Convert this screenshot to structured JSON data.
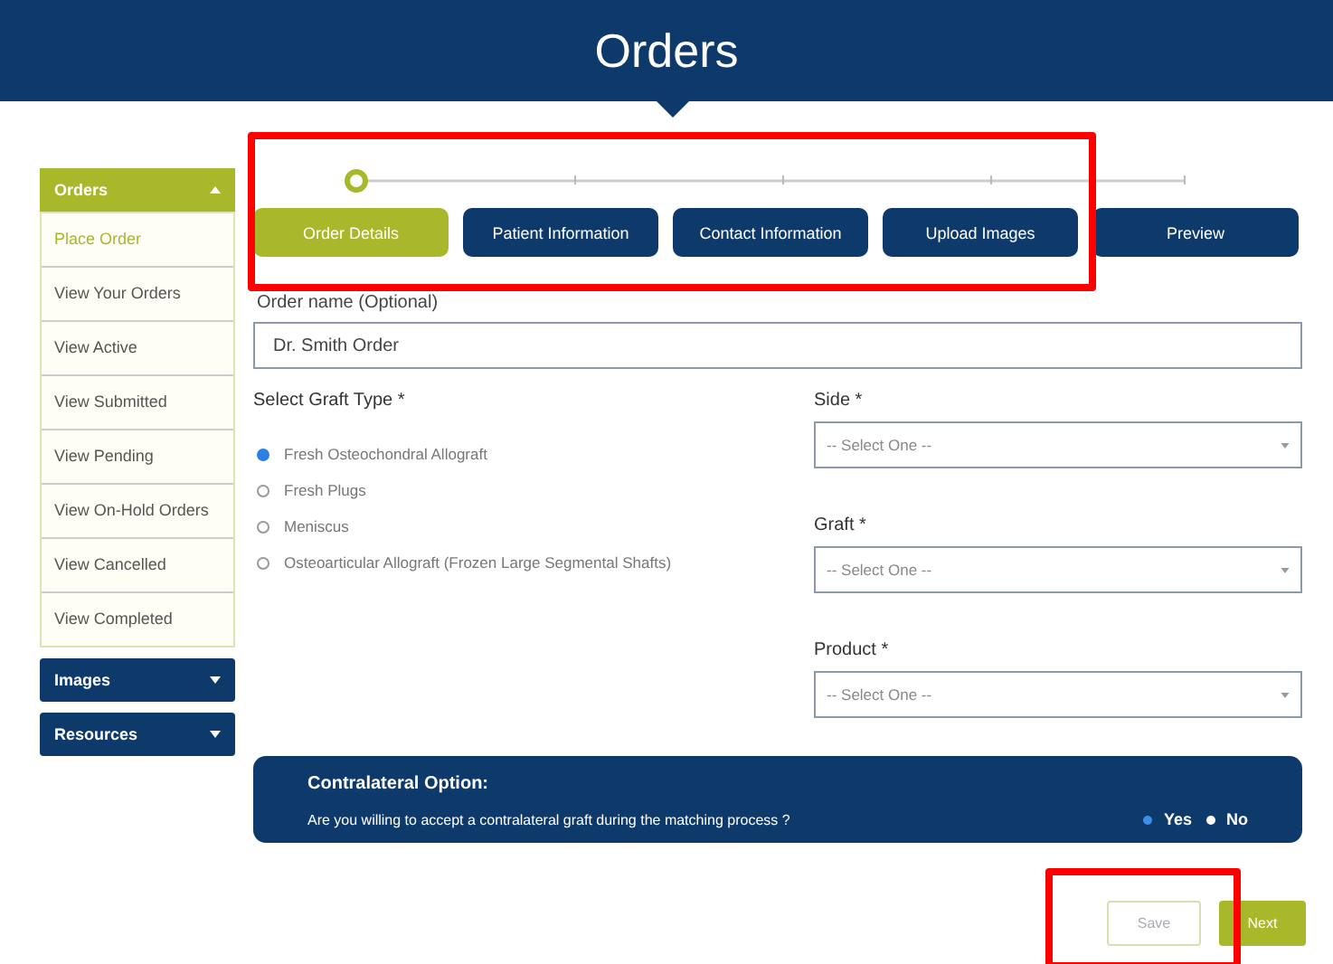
{
  "header": {
    "title": "Orders"
  },
  "sidebar": {
    "sections": [
      {
        "label": "Orders",
        "expanded": true,
        "items": [
          {
            "label": "Place Order",
            "selected": true
          },
          {
            "label": "View Your Orders",
            "selected": false
          },
          {
            "label": "View Active",
            "selected": false
          },
          {
            "label": "View Submitted",
            "selected": false
          },
          {
            "label": "View Pending",
            "selected": false
          },
          {
            "label": "View On-Hold Orders",
            "selected": false
          },
          {
            "label": "View Cancelled",
            "selected": false
          },
          {
            "label": "View Completed",
            "selected": false
          }
        ]
      },
      {
        "label": "Images",
        "expanded": false
      },
      {
        "label": "Resources",
        "expanded": false
      }
    ]
  },
  "steps": [
    {
      "label": "Order Details",
      "selected": true
    },
    {
      "label": "Patient Information",
      "selected": false
    },
    {
      "label": "Contact Information",
      "selected": false
    },
    {
      "label": "Upload Images",
      "selected": false
    },
    {
      "label": "Preview",
      "selected": false
    }
  ],
  "order_name": {
    "label": "Order name (Optional)",
    "value": "Dr. Smith Order"
  },
  "graft_type": {
    "label": "Select Graft Type *",
    "options": [
      {
        "label": "Fresh Osteochondral Allograft",
        "selected": true
      },
      {
        "label": "Fresh Plugs",
        "selected": false
      },
      {
        "label": "Meniscus",
        "selected": false
      },
      {
        "label": "Osteoarticular Allograft (Frozen Large Segmental Shafts)",
        "selected": false
      }
    ]
  },
  "selects": [
    {
      "label": "Side *",
      "placeholder": "-- Select One --"
    },
    {
      "label": "Graft *",
      "placeholder": "-- Select One --"
    },
    {
      "label": "Product *",
      "placeholder": "-- Select One --"
    }
  ],
  "contralateral": {
    "title": "Contralateral Option:",
    "question": "Are you willing to accept a contralateral graft during the matching process ?",
    "options": [
      {
        "label": "Yes",
        "selected": true
      },
      {
        "label": "No",
        "selected": false
      }
    ]
  },
  "buttons": [
    {
      "label": "Save",
      "kind": "outline"
    },
    {
      "label": "Next",
      "kind": "filled"
    }
  ]
}
